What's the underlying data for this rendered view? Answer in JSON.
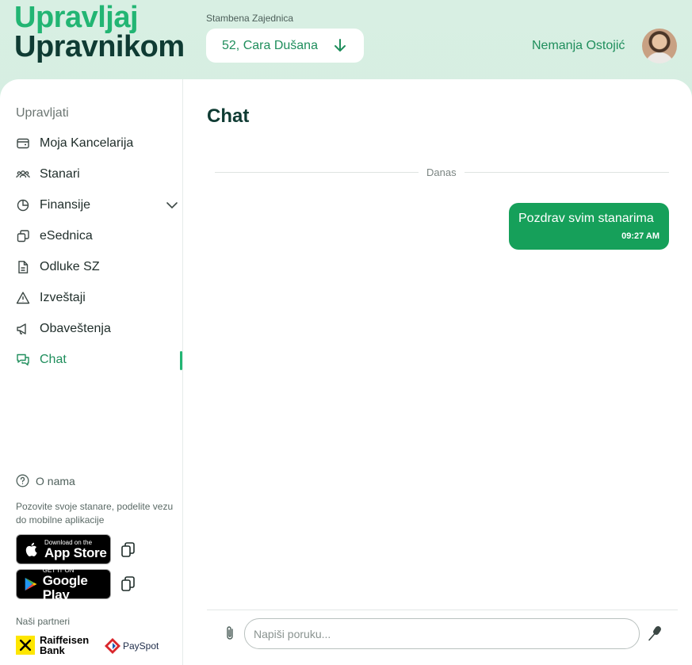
{
  "brand": {
    "line1": "Upravljaj",
    "line2": "Upravnikom"
  },
  "header": {
    "community_label": "Stambena Zajednica",
    "community_value": "52, Cara Dušana",
    "user_name": "Nemanja Ostojić"
  },
  "sidebar": {
    "section_title": "Upravljati",
    "items": [
      {
        "label": "Moja Kancelarija",
        "icon": "wallet-icon"
      },
      {
        "label": "Stanari",
        "icon": "people-icon"
      },
      {
        "label": "Finansije",
        "icon": "pie-chart-icon"
      },
      {
        "label": "eSednica",
        "icon": "copy-squares-icon"
      },
      {
        "label": "Odluke SZ",
        "icon": "document-icon"
      },
      {
        "label": "Izveštaji",
        "icon": "warning-icon"
      },
      {
        "label": "Obaveštenja",
        "icon": "megaphone-icon"
      },
      {
        "label": "Chat",
        "icon": "chat-icon",
        "active": true
      }
    ],
    "about": "O nama",
    "invite_text": "Pozovite svoje stanare, podelite vezu do mobilne aplikacije",
    "app_store": {
      "small": "Download on the",
      "big": "App Store"
    },
    "google_play": {
      "small": "GET IT ON",
      "big": "Google Play"
    },
    "partners_label": "Naši partneri",
    "partner1": {
      "line1": "Raiffeisen",
      "line2": "Bank"
    },
    "partner2": "PaySpot"
  },
  "main": {
    "title": "Chat",
    "day_divider": "Danas",
    "messages": [
      {
        "text": "Pozdrav svim stanarima",
        "time": "09:27 AM"
      }
    ],
    "composer_placeholder": "Napiši poruku..."
  },
  "colors": {
    "accent": "#22b573",
    "accent_dark": "#1f8e5c",
    "bubble": "#16a05a",
    "brand_dark": "#0f3b33"
  }
}
